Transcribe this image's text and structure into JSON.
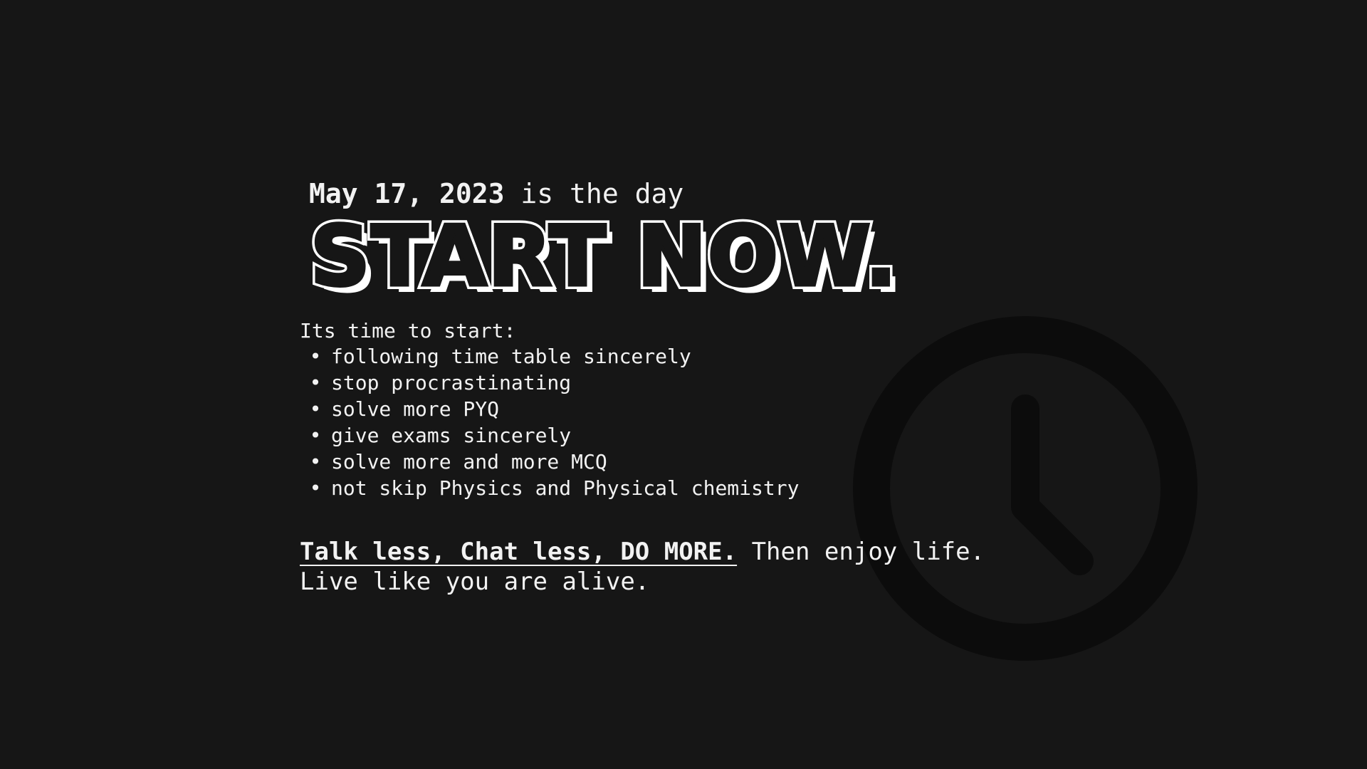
{
  "date_line": {
    "date": "May 17, 2023",
    "rest": " is the day"
  },
  "headline": "START NOW.",
  "intro": "Its time to start:",
  "bullet_glyph": "•",
  "todo_items": [
    "following time table sincerely",
    "stop procrastinating",
    "solve more PYQ",
    "give exams sincerely",
    "solve more and more MCQ",
    "not skip Physics and Physical chemistry"
  ],
  "motto": {
    "emphasis": "Talk less, Chat less, DO MORE.",
    "rest": " Then enjoy life.",
    "line2": "Live like you are alive."
  },
  "icons": {
    "background": "clock-icon"
  },
  "colors": {
    "background": "#161616",
    "text": "#f2f2f2",
    "clock": "#0c0c0c"
  }
}
